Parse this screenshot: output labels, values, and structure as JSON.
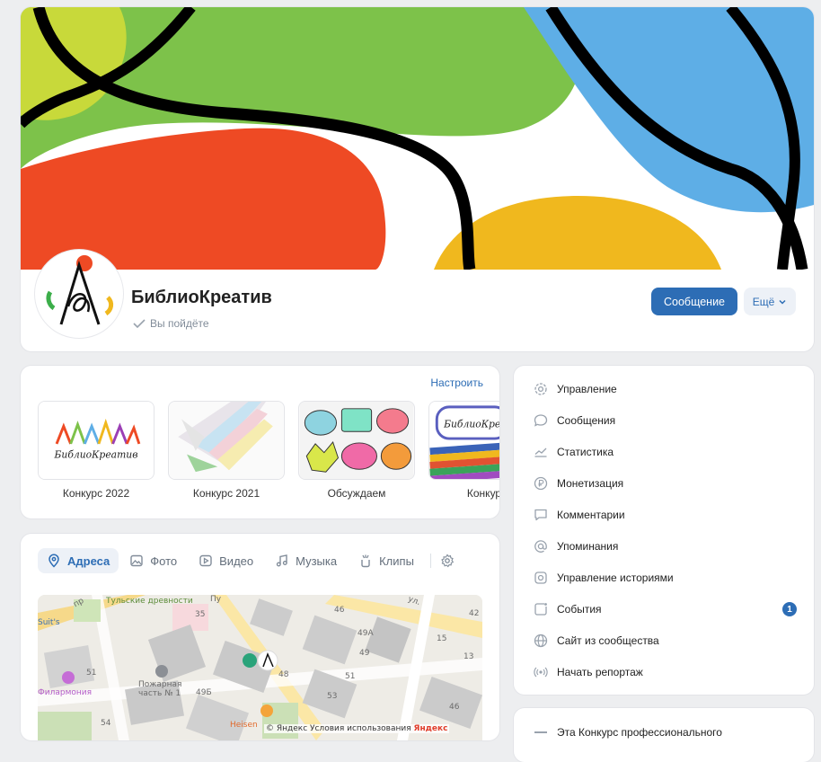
{
  "group": {
    "name": "БиблиоКреатив",
    "status": "Вы пойдёте",
    "message_button": "Сообщение",
    "more_button": "Ещё"
  },
  "albums": {
    "setup_link": "Настроить",
    "items": [
      {
        "caption": "Конкурс 2022",
        "thumb_text": "БиблиоКреатив"
      },
      {
        "caption": "Конкурс 2021"
      },
      {
        "caption": "Обсуждаем"
      },
      {
        "caption": "Конкурс",
        "thumb_text": "БиблиоКре"
      }
    ]
  },
  "media_tabs": [
    {
      "label": "Адреса",
      "icon": "location-pin-icon",
      "active": true
    },
    {
      "label": "Фото",
      "icon": "photo-icon"
    },
    {
      "label": "Видео",
      "icon": "video-icon"
    },
    {
      "label": "Музыка",
      "icon": "music-note-icon"
    },
    {
      "label": "Клипы",
      "icon": "clips-icon"
    }
  ],
  "map": {
    "labels": {
      "tulskie": "Тульские древности",
      "philharmonia": "Филармония",
      "fire_station": "Пожарная часть № 1",
      "heisen": "Heisen",
      "copyright": "© Яндекс Условия использования",
      "yandex": "Яндекс",
      "suits": "Suit's",
      "n35": "35",
      "n46a": "46",
      "n49a": "49А",
      "n15": "15",
      "n42": "42",
      "n49": "49",
      "n48": "48",
      "n51a": "51",
      "n51b": "51",
      "n13": "13",
      "n49b": "49Б",
      "n53": "53",
      "n46b": "46",
      "n54": "54",
      "street_pu": "Пу",
      "street_ul": "ул.",
      "street_pr": "пр"
    }
  },
  "menu": {
    "items": [
      {
        "label": "Управление",
        "icon": "gear-icon"
      },
      {
        "label": "Сообщения",
        "icon": "message-bubble-icon"
      },
      {
        "label": "Статистика",
        "icon": "stats-chart-icon"
      },
      {
        "label": "Монетизация",
        "icon": "ruble-coin-icon"
      },
      {
        "label": "Комментарии",
        "icon": "comment-icon"
      },
      {
        "label": "Упоминания",
        "icon": "at-sign-icon"
      },
      {
        "label": "Управление историями",
        "icon": "stories-icon"
      },
      {
        "label": "События",
        "icon": "event-icon",
        "badge": "1"
      },
      {
        "label": "Сайт из сообщества",
        "icon": "globe-icon"
      },
      {
        "label": "Начать репортаж",
        "icon": "live-broadcast-icon"
      }
    ]
  },
  "post": {
    "text": "Эта Конкурс профессионального"
  },
  "colors": {
    "accent": "#2d6db5",
    "cover_green": "#7dc24a",
    "cover_blue": "#5eaee6",
    "cover_orange": "#ee4a24",
    "cover_yellow": "#f0b81e",
    "cover_lime": "#c8d93a"
  }
}
